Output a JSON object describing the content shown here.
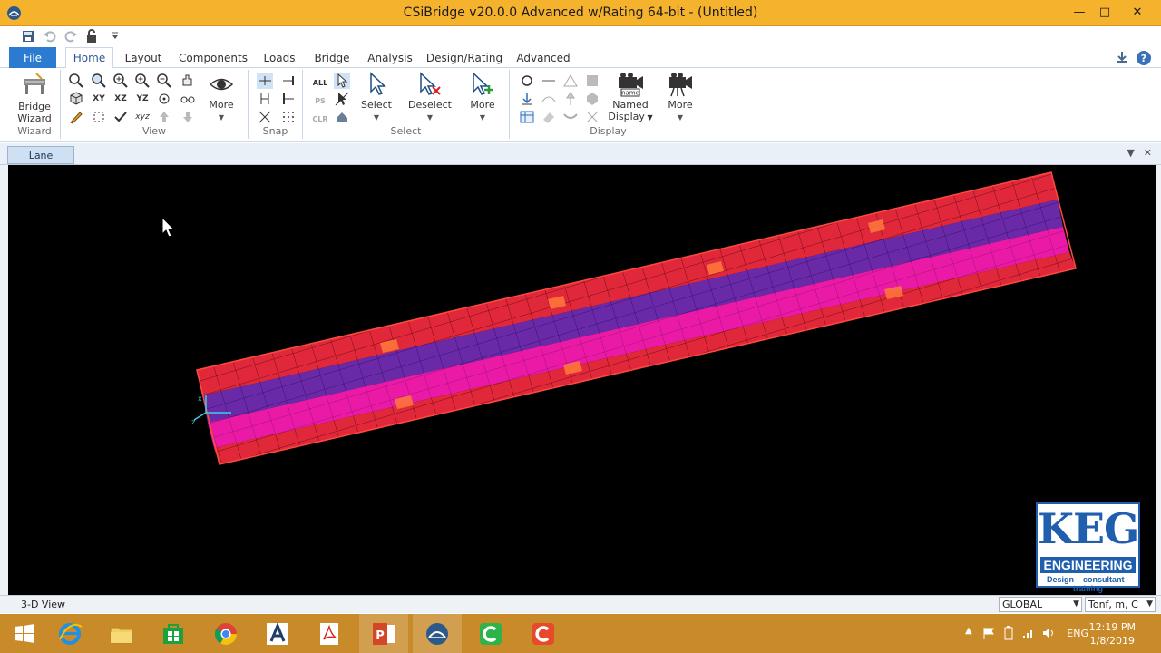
{
  "window": {
    "title": "CSiBridge v20.0.0 Advanced w/Rating 64-bit - (Untitled)",
    "minimize": "—",
    "maximize": "□",
    "close": "✕"
  },
  "ribbon_tabs": [
    {
      "label": "File"
    },
    {
      "label": "Home"
    },
    {
      "label": "Layout"
    },
    {
      "label": "Components"
    },
    {
      "label": "Loads"
    },
    {
      "label": "Bridge"
    },
    {
      "label": "Analysis"
    },
    {
      "label": "Design/Rating"
    },
    {
      "label": "Advanced"
    }
  ],
  "ribbon": {
    "bridge_wizard_label_1": "Bridge",
    "bridge_wizard_label_2": "Wizard",
    "wizard_group_label": "Wizard",
    "view_group_label": "View",
    "view_more_label": "More",
    "view_xy": "XY",
    "view_xz": "XZ",
    "view_yz": "YZ",
    "view_xyz": "xyz",
    "snap_group_label": "Snap",
    "select_all": "ALL",
    "select_ps": "PS",
    "select_clr": "CLR",
    "select_label": "Select",
    "deselect_label": "Deselect",
    "select_more_label": "More",
    "select_group_label": "Select",
    "named_display_label_1": "Named",
    "named_display_label_2": "Display",
    "named_display_icon_text": "name",
    "display_more_label": "More",
    "display_group_label": "Display"
  },
  "document": {
    "tab_label": "Lane"
  },
  "viewport": {
    "axis_labels": {
      "x": "x",
      "z": "z"
    }
  },
  "logo": {
    "big_text": "KEG",
    "sub_text": "ENGINEERING",
    "tagline": "Design – consultant - training"
  },
  "statusbar": {
    "view_text": "3-D View",
    "coord_system": "GLOBAL",
    "units": "Tonf, m, C"
  },
  "taskbar": {
    "language": "ENG",
    "time": "12:19 PM",
    "date": "1/8/2019"
  },
  "colors": {
    "titlebar": "#f5b22c",
    "taskbar": "#c98a2a",
    "deck_red": "#e0283a",
    "deck_purple": "#6a2aa8",
    "deck_magenta": "#ea1aa6",
    "logo_blue": "#1f5fae"
  }
}
